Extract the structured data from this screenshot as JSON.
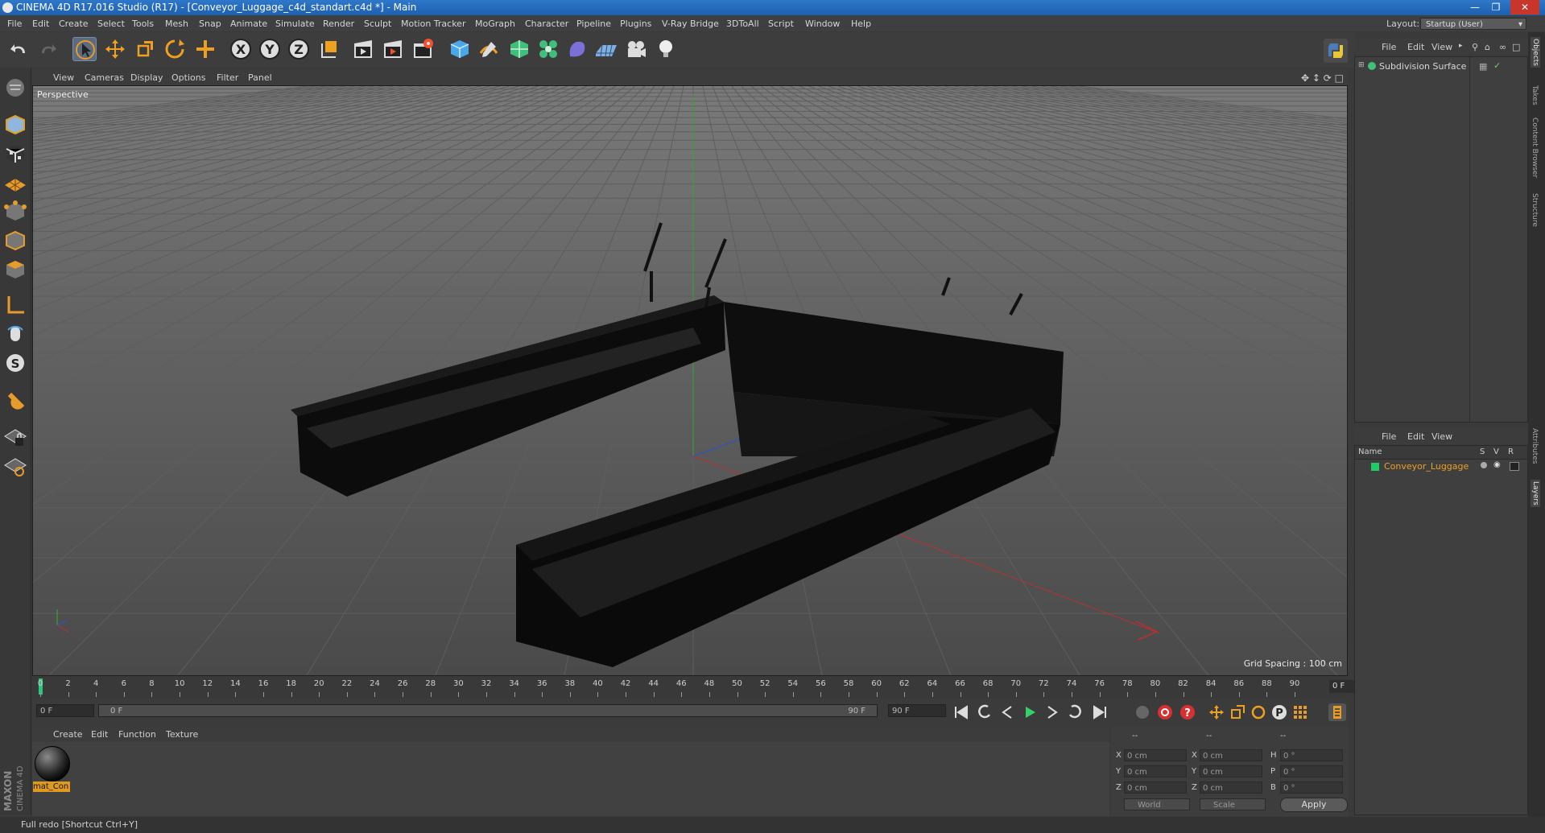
{
  "window": {
    "title": "CINEMA 4D R17.016 Studio (R17) - [Conveyor_Luggage_c4d_standart.c4d *] - Main"
  },
  "menubar": {
    "items": [
      "File",
      "Edit",
      "Create",
      "Select",
      "Tools",
      "Mesh",
      "Snap",
      "Animate",
      "Simulate",
      "Render",
      "Sculpt",
      "Motion Tracker",
      "MoGraph",
      "Character",
      "Pipeline",
      "Plugins",
      "V-Ray Bridge",
      "3DToAll",
      "Script",
      "Window",
      "Help"
    ],
    "layout_label": "Layout:",
    "layout_value": "Startup (User)"
  },
  "toolbar": {
    "icons": [
      "undo-icon",
      "redo-icon",
      "select-arrow-icon",
      "move-icon",
      "scale-icon",
      "rotate-icon",
      "create-icon",
      "x-axis-icon",
      "y-axis-icon",
      "z-axis-icon",
      "coordinate-system-icon",
      "render-view-icon",
      "render-picture-viewer-icon",
      "edit-render-settings-icon",
      "cube-icon",
      "pen-icon",
      "subdivision-icon",
      "cloner-icon",
      "deformer-icon",
      "floor-icon",
      "camera-icon",
      "light-icon"
    ]
  },
  "viewport": {
    "menu": [
      "View",
      "Cameras",
      "Display",
      "Options",
      "Filter",
      "Panel"
    ],
    "label": "Perspective",
    "grid_spacing": "Grid Spacing : 100 cm"
  },
  "timeline": {
    "ticks": [
      "0",
      "2",
      "4",
      "6",
      "8",
      "10",
      "12",
      "14",
      "16",
      "18",
      "20",
      "22",
      "24",
      "26",
      "28",
      "30",
      "32",
      "34",
      "36",
      "38",
      "40",
      "42",
      "44",
      "46",
      "48",
      "50",
      "52",
      "54",
      "56",
      "58",
      "60",
      "62",
      "64",
      "66",
      "68",
      "70",
      "72",
      "74",
      "76",
      "78",
      "80",
      "82",
      "84",
      "86",
      "88",
      "90"
    ],
    "current_frame": "0 F"
  },
  "transport": {
    "start_field": "0 F",
    "range_start": "0 F",
    "range_end": "90 F",
    "end_field": "90 F"
  },
  "material_manager": {
    "menu": [
      "Create",
      "Edit",
      "Function",
      "Texture"
    ],
    "materials": [
      {
        "name": "mat_Con"
      }
    ]
  },
  "coordinates": {
    "headers": [
      "--",
      "--",
      "--"
    ],
    "rows": [
      {
        "a": "X",
        "av": "0 cm",
        "b": "X",
        "bv": "0 cm",
        "c": "H",
        "cv": "0 °"
      },
      {
        "a": "Y",
        "av": "0 cm",
        "b": "Y",
        "bv": "0 cm",
        "c": "P",
        "cv": "0 °"
      },
      {
        "a": "Z",
        "av": "0 cm",
        "b": "Z",
        "bv": "0 cm",
        "c": "B",
        "cv": "0 °"
      }
    ],
    "mode1": "World",
    "mode2": "Scale",
    "apply": "Apply"
  },
  "status": {
    "text": "Full redo [Shortcut Ctrl+Y]"
  },
  "branding": {
    "maxon": "MAXON",
    "cinema": "CINEMA 4D"
  },
  "object_manager": {
    "menu": [
      "File",
      "Edit",
      "View"
    ],
    "objects": [
      {
        "name": "Subdivision Surface"
      }
    ]
  },
  "layer_manager": {
    "menu": [
      "File",
      "Edit",
      "View"
    ],
    "columns": {
      "name": "Name",
      "s": "S",
      "v": "V",
      "r": "R"
    },
    "layers": [
      {
        "name": "Conveyor_Luggage",
        "color": "#1fcc66"
      }
    ]
  },
  "right_tabs": {
    "top": [
      "Objects",
      "Takes",
      "Content Browser",
      "Structure"
    ],
    "bottom": [
      "Attributes",
      "Layers"
    ]
  },
  "colors": {
    "accent": "#e09a1e",
    "title_bar": "#1d5fb0",
    "axis_x": "#c03030",
    "axis_y": "#30b030",
    "axis_z": "#3050d0"
  }
}
